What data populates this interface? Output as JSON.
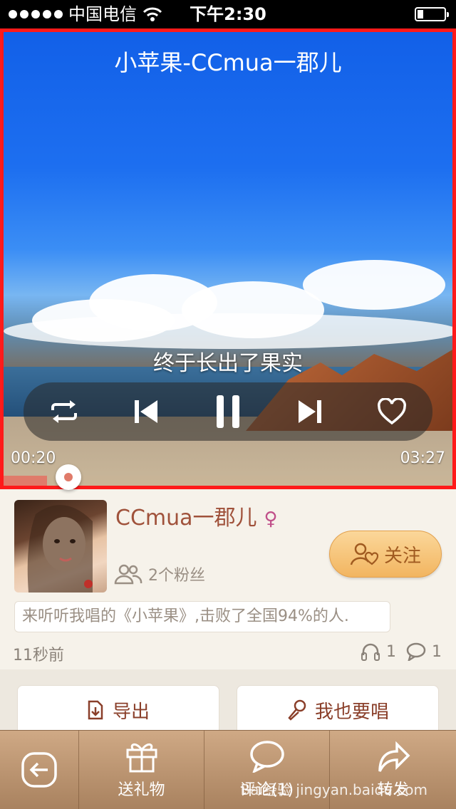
{
  "status_bar": {
    "carrier": "中国电信",
    "time": "下午2:30"
  },
  "player": {
    "song_title": "小苹果-CCmua一郡儿",
    "lyric": "终于长出了果实",
    "current_time": "00:20",
    "total_time": "03:27",
    "progress": 0.097
  },
  "user": {
    "name": "CCmua一郡儿",
    "gender_symbol": "♀",
    "fans": "2个粉丝",
    "follow_label": "关注",
    "description": "来听听我唱的《小苹果》,击败了全国94%的人.",
    "posted": "11秒前",
    "listens": "1",
    "comments": "1"
  },
  "actions": {
    "export_label": "导出",
    "sing_label": "我也要唱"
  },
  "tabs": {
    "gift": "送礼物",
    "comment": "评论(1)",
    "forward": "转发"
  },
  "watermark": "Bai经验 jingyan.baidu.com"
}
